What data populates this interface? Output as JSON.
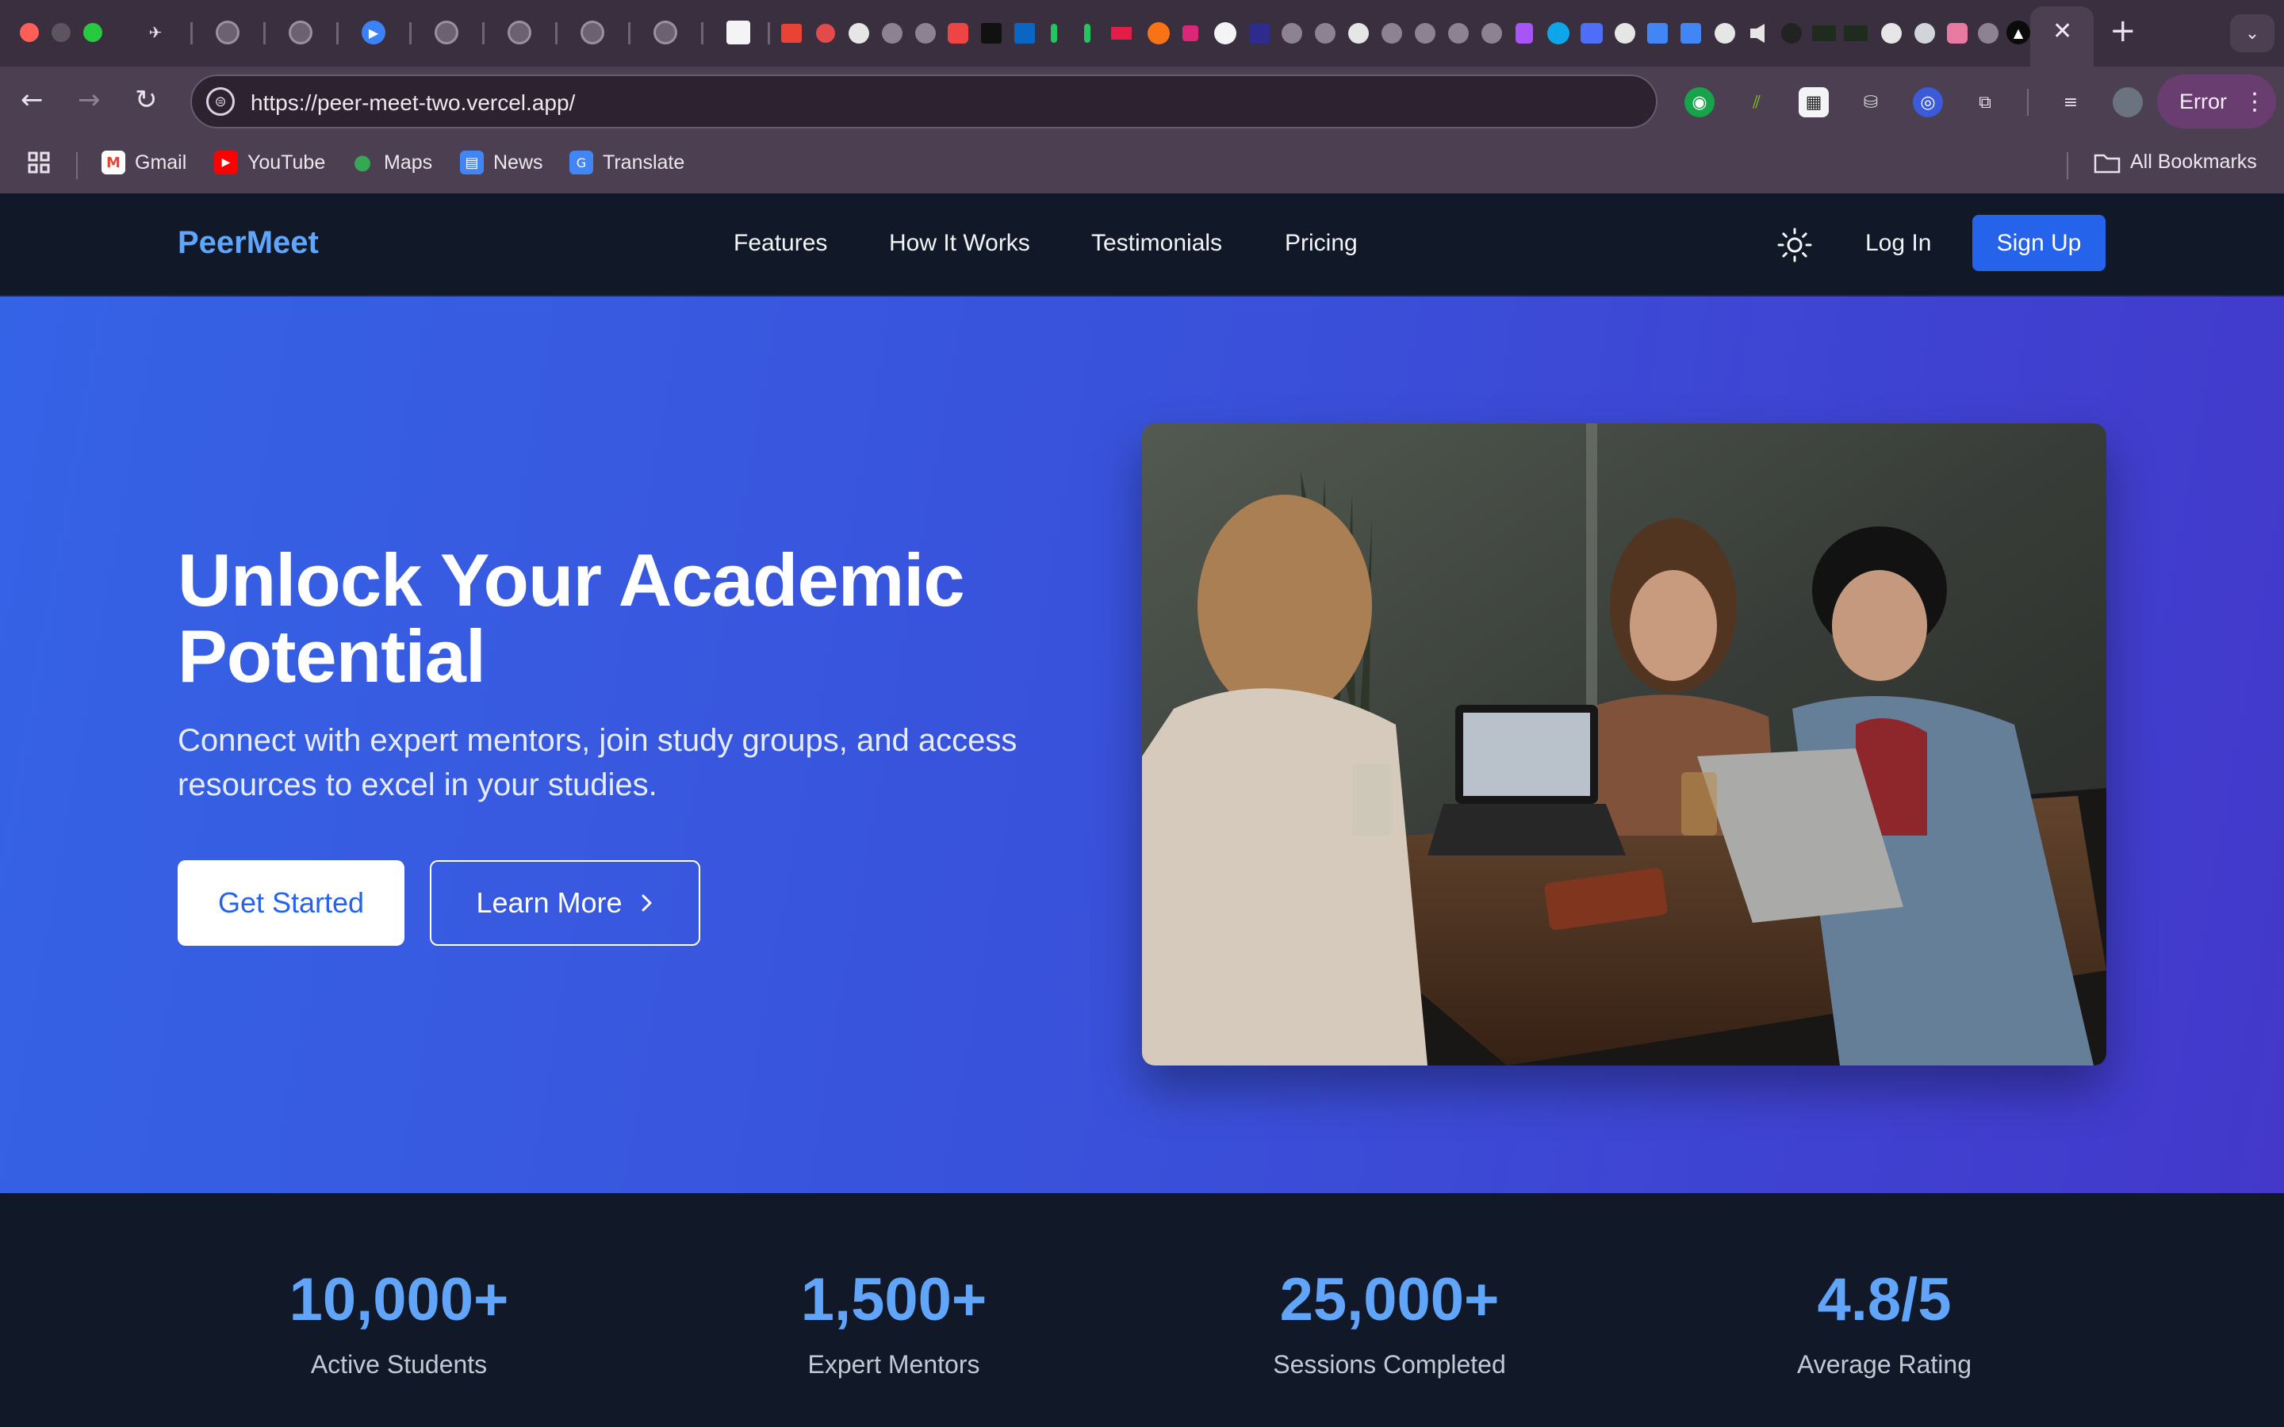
{
  "browser": {
    "url": "https://peer-meet-two.vercel.app/",
    "profile_label": "Error",
    "bookmarks": [
      {
        "label": "Gmail",
        "icon": "gmail-icon"
      },
      {
        "label": "YouTube",
        "icon": "youtube-icon"
      },
      {
        "label": "Maps",
        "icon": "maps-icon"
      },
      {
        "label": "News",
        "icon": "news-icon"
      },
      {
        "label": "Translate",
        "icon": "translate-icon"
      }
    ],
    "all_bookmarks_label": "All Bookmarks"
  },
  "header": {
    "logo": "PeerMeet",
    "nav": [
      "Features",
      "How It Works",
      "Testimonials",
      "Pricing"
    ],
    "login_label": "Log In",
    "signup_label": "Sign Up"
  },
  "hero": {
    "title": "Unlock Your Academic Potential",
    "subtitle": "Connect with expert mentors, join study groups, and access resources to excel in your studies.",
    "primary_cta": "Get Started",
    "secondary_cta": "Learn More"
  },
  "stats": [
    {
      "value": "10,000+",
      "label": "Active Students"
    },
    {
      "value": "1,500+",
      "label": "Expert Mentors"
    },
    {
      "value": "25,000+",
      "label": "Sessions Completed"
    },
    {
      "value": "4.8/5",
      "label": "Average Rating"
    }
  ],
  "colors": {
    "brand": "#60a5fa",
    "primary": "#2563eb",
    "hero_gradient_start": "#3563e6",
    "hero_gradient_end": "#4338ca",
    "dark_bg": "#111827"
  }
}
